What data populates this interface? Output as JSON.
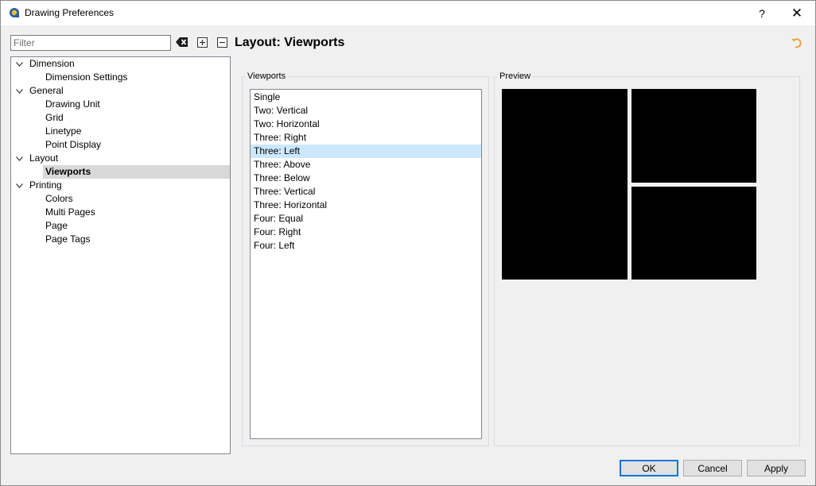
{
  "window": {
    "title": "Drawing Preferences",
    "help_glyph": "?",
    "close_glyph": "✕"
  },
  "filter": {
    "placeholder": "Filter",
    "value": ""
  },
  "toolbar_icons": [
    "clear-filter-icon",
    "expand-all-icon",
    "collapse-all-icon"
  ],
  "tree": {
    "dimension": "Dimension",
    "dimension_settings": "Dimension Settings",
    "general": "General",
    "drawing_unit": "Drawing Unit",
    "grid": "Grid",
    "linetype": "Linetype",
    "point_display": "Point Display",
    "layout": "Layout",
    "viewports": "Viewports",
    "printing": "Printing",
    "colors": "Colors",
    "multi_pages": "Multi Pages",
    "page": "Page",
    "page_tags": "Page Tags",
    "selected": "Viewports"
  },
  "page": {
    "title": "Layout: Viewports",
    "undo_icon": "undo-icon"
  },
  "viewports_group": {
    "title": "Viewports",
    "items": [
      "Single",
      "Two: Vertical",
      "Two: Horizontal",
      "Three: Right",
      "Three: Left",
      "Three: Above",
      "Three: Below",
      "Three: Vertical",
      "Three: Horizontal",
      "Four: Equal",
      "Four: Right",
      "Four: Left"
    ],
    "selected": "Three: Left"
  },
  "preview_group": {
    "title": "Preview"
  },
  "buttons": {
    "ok": "OK",
    "cancel": "Cancel",
    "apply": "Apply"
  },
  "colors": {
    "selection_tree": "#d9d9d9",
    "selection_list": "#cce8ff",
    "default_button_border": "#0078d7",
    "preview_fill": "#000000",
    "undo_icon": "#e8a33a"
  }
}
